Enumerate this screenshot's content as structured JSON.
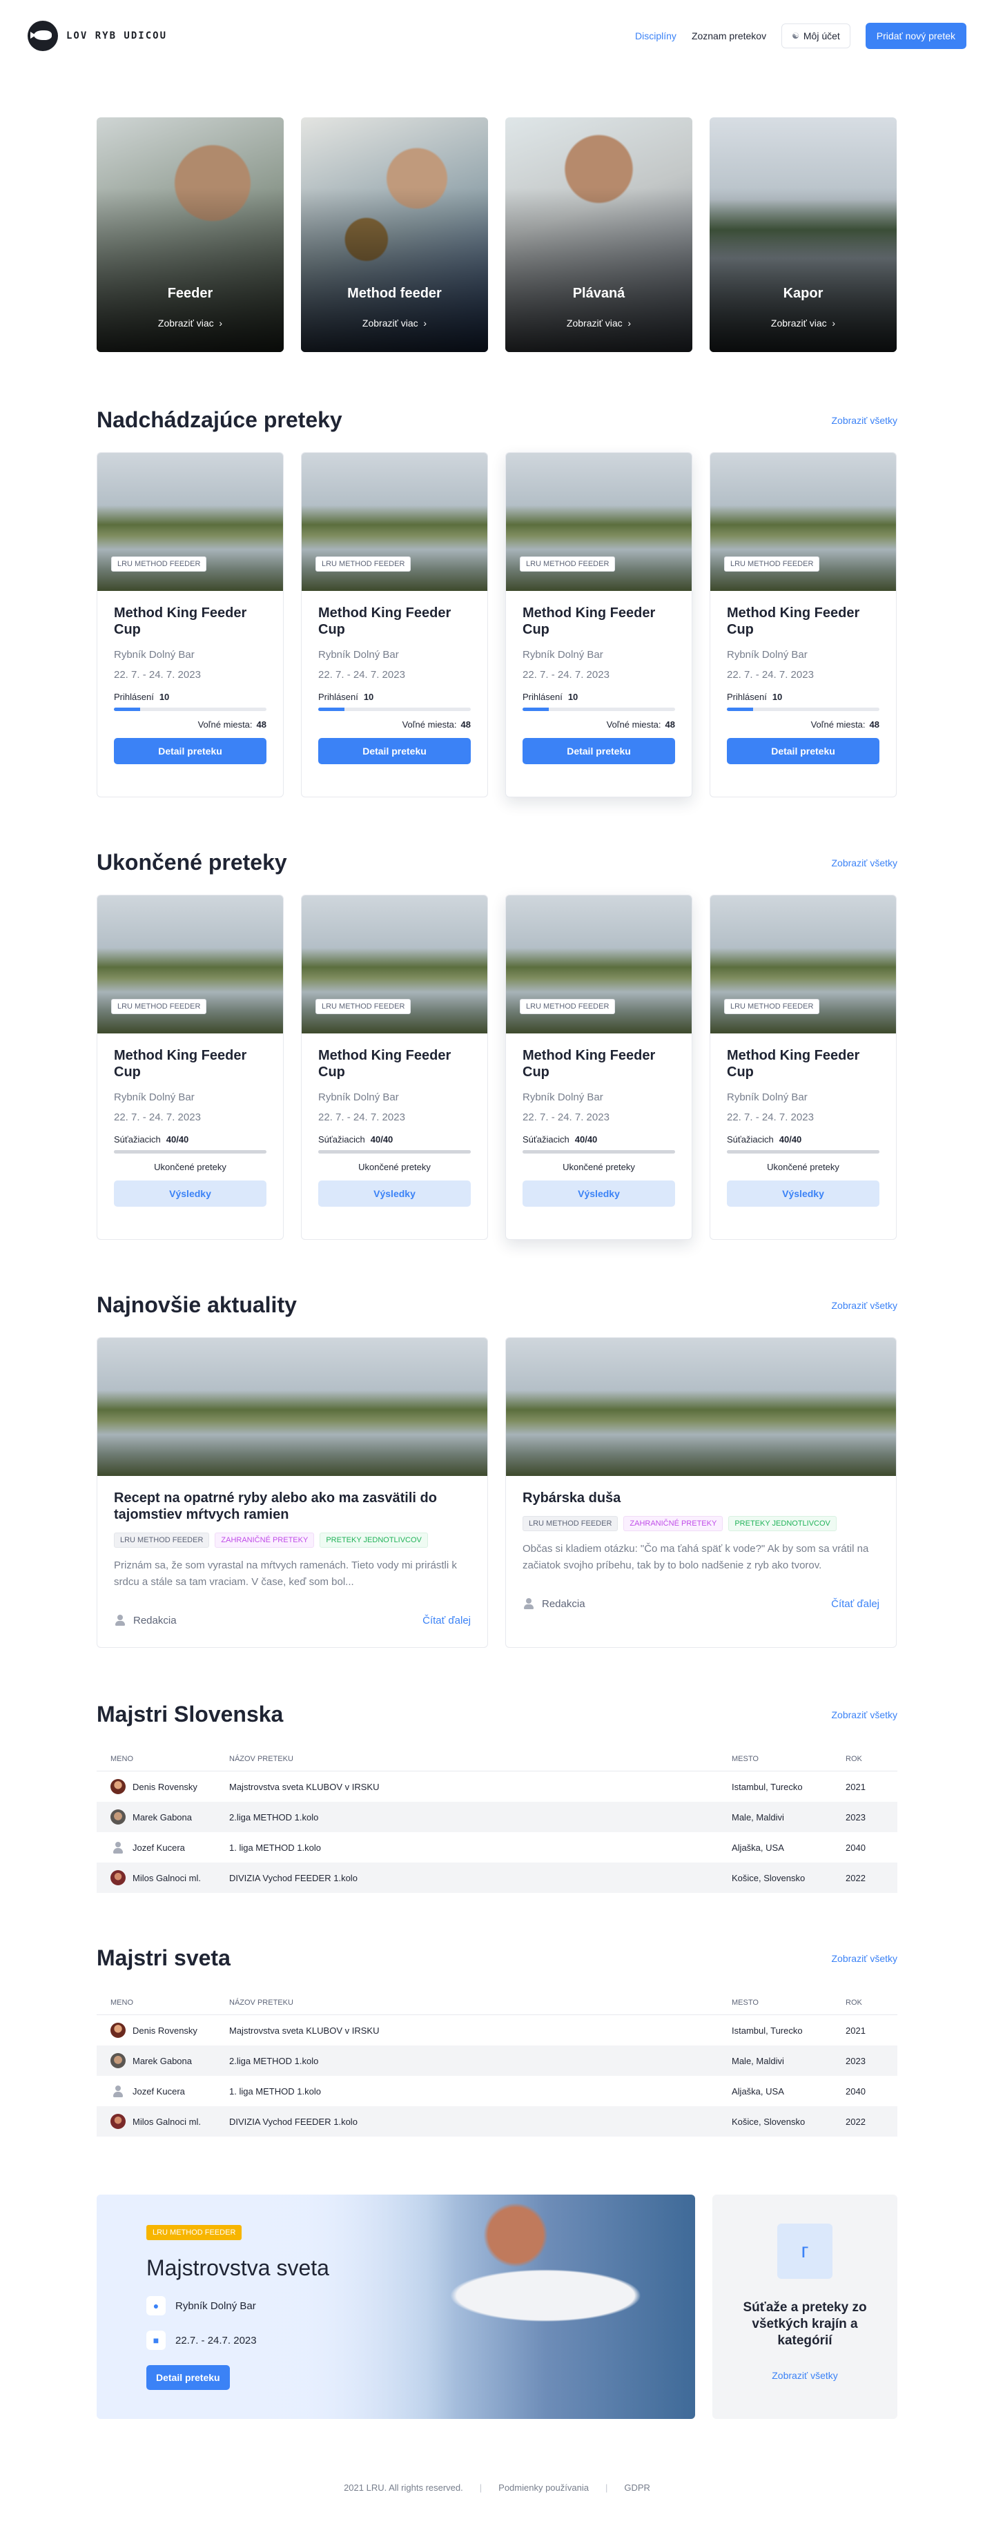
{
  "header": {
    "logo_text": "LOV RYB UDICOU",
    "nav": [
      {
        "label": "Disciplíny",
        "active": true
      },
      {
        "label": "Zoznam pretekov",
        "active": false
      }
    ],
    "account_label": "Môj účet",
    "add_race_label": "Pridať nový pretek"
  },
  "disciplines": [
    {
      "name": "Feeder",
      "more": "Zobraziť viac"
    },
    {
      "name": "Method feeder",
      "more": "Zobraziť viac"
    },
    {
      "name": "Plávaná",
      "more": "Zobraziť viac"
    },
    {
      "name": "Kapor",
      "more": "Zobraziť viac"
    }
  ],
  "upcoming": {
    "title": "Nadchádzajúce preteky",
    "see_all": "Zobraziť všetky",
    "cards": [
      {
        "tag": "LRU METHOD FEEDER",
        "title": "Method King Feeder Cup",
        "place": "Rybník Dolný Bar",
        "date": "22. 7. - 24. 7. 2023",
        "reg_label": "Prihlásení",
        "reg_value": "10",
        "progress": 0.17,
        "free_label": "Voľné miesta:",
        "free_value": "48",
        "button": "Detail preteku"
      },
      {
        "tag": "LRU METHOD FEEDER",
        "title": "Method King Feeder Cup",
        "place": "Rybník Dolný Bar",
        "date": "22. 7. - 24. 7. 2023",
        "reg_label": "Prihlásení",
        "reg_value": "10",
        "progress": 0.17,
        "free_label": "Voľné miesta:",
        "free_value": "48",
        "button": "Detail preteku"
      },
      {
        "tag": "LRU METHOD FEEDER",
        "title": "Method King Feeder Cup",
        "place": "Rybník Dolný Bar",
        "date": "22. 7. - 24. 7. 2023",
        "reg_label": "Prihlásení",
        "reg_value": "10",
        "progress": 0.17,
        "free_label": "Voľné miesta:",
        "free_value": "48",
        "button": "Detail preteku"
      },
      {
        "tag": "LRU METHOD FEEDER",
        "title": "Method King Feeder Cup",
        "place": "Rybník Dolný Bar",
        "date": "22. 7. - 24. 7. 2023",
        "reg_label": "Prihlásení",
        "reg_value": "10",
        "progress": 0.17,
        "free_label": "Voľné miesta:",
        "free_value": "48",
        "button": "Detail preteku"
      }
    ]
  },
  "finished": {
    "title": "Ukončené preteky",
    "see_all": "Zobraziť všetky",
    "cards": [
      {
        "tag": "LRU METHOD FEEDER",
        "title": "Method King Feeder Cup",
        "place": "Rybník Dolný Bar",
        "date": "22. 7. - 24. 7. 2023",
        "reg_label": "Súťažiacich",
        "reg_value": "40/40",
        "progress": 1.0,
        "status": "Ukončené preteky",
        "button": "Výsledky"
      },
      {
        "tag": "LRU METHOD FEEDER",
        "title": "Method King Feeder Cup",
        "place": "Rybník Dolný Bar",
        "date": "22. 7. - 24. 7. 2023",
        "reg_label": "Súťažiacich",
        "reg_value": "40/40",
        "progress": 1.0,
        "status": "Ukončené preteky",
        "button": "Výsledky"
      },
      {
        "tag": "LRU METHOD FEEDER",
        "title": "Method King Feeder Cup",
        "place": "Rybník Dolný Bar",
        "date": "22. 7. - 24. 7. 2023",
        "reg_label": "Súťažiacich",
        "reg_value": "40/40",
        "progress": 1.0,
        "status": "Ukončené preteky",
        "button": "Výsledky"
      },
      {
        "tag": "LRU METHOD FEEDER",
        "title": "Method King Feeder Cup",
        "place": "Rybník Dolný Bar",
        "date": "22. 7. - 24. 7. 2023",
        "reg_label": "Súťažiacich",
        "reg_value": "40/40",
        "progress": 1.0,
        "status": "Ukončené preteky",
        "button": "Výsledky"
      }
    ]
  },
  "news": {
    "title": "Najnovšie aktuality",
    "see_all": "Zobraziť všetky",
    "items": [
      {
        "title": "Recept na opatrné ryby alebo ako ma zasvätili do tajomstiev mŕtvych ramien",
        "tags": [
          "LRU METHOD FEEDER",
          "ZAHRANIČNÉ PRETEKY",
          "PRETEKY JEDNOTLIVCOV"
        ],
        "excerpt": "Priznám sa, že som vyrastal na mŕtvych ramenách. Tieto vody mi prirástli k srdcu a stále sa tam vraciam. V čase, keď som bol...",
        "author": "Redakcia",
        "read_more": "Čítať ďalej"
      },
      {
        "title": "Rybárska duša",
        "tags": [
          "LRU METHOD FEEDER",
          "ZAHRANIČNÉ PRETEKY",
          "PRETEKY JEDNOTLIVCOV"
        ],
        "excerpt": "Občas si kladiem otázku: \"Čo ma ťahá späť k vode?\" Ak by som sa vrátil na začiatok svojho príbehu, tak by to bolo nadšenie z ryb ako tvorov.",
        "author": "Redakcia",
        "read_more": "Čítať ďalej"
      }
    ]
  },
  "masters_sk": {
    "title": "Majstri Slovenska",
    "see_all": "Zobraziť všetky",
    "headers": [
      "MENO",
      "NÁZOV PRETEKU",
      "MESTO",
      "ROK"
    ],
    "rows": [
      {
        "name": "Denis Rovensky",
        "race": "Majstrovstva sveta KLUBOV v IRSKU",
        "city": "Istambul, Turecko",
        "year": "2021"
      },
      {
        "name": "Marek Gabona",
        "race": "2.liga METHOD 1.kolo",
        "city": "Male, Maldivi",
        "year": "2023"
      },
      {
        "name": "Jozef Kucera",
        "race": "1. liga METHOD 1.kolo",
        "city": "Aljaška, USA",
        "year": "2040"
      },
      {
        "name": "Milos Galnoci ml.",
        "race": "DIVIZIA Vychod FEEDER 1.kolo",
        "city": "Košice, Slovensko",
        "year": "2022"
      }
    ]
  },
  "masters_world": {
    "title": "Majstri sveta",
    "see_all": "Zobraziť všetky",
    "headers": [
      "MENO",
      "NÁZOV PRETEKU",
      "MESTO",
      "ROK"
    ],
    "rows": [
      {
        "name": "Denis Rovensky",
        "race": "Majstrovstva sveta KLUBOV v IRSKU",
        "city": "Istambul, Turecko",
        "year": "2021"
      },
      {
        "name": "Marek Gabona",
        "race": "2.liga METHOD 1.kolo",
        "city": "Male, Maldivi",
        "year": "2023"
      },
      {
        "name": "Jozef Kucera",
        "race": "1. liga METHOD 1.kolo",
        "city": "Aljaška, USA",
        "year": "2040"
      },
      {
        "name": "Milos Galnoci ml.",
        "race": "DIVIZIA Vychod FEEDER 1.kolo",
        "city": "Košice, Slovensko",
        "year": "2022"
      }
    ]
  },
  "promo": {
    "tag": "LRU METHOD FEEDER",
    "title": "Majstrovstva sveta",
    "place": "Rybník Dolný Bar",
    "date": "22.7. - 24.7. 2023",
    "button": "Detail preteku",
    "side_text": "Súťaže a preteky zo všetkých krajín a kategórií",
    "side_link": "Zobraziť všetky"
  },
  "footer": {
    "copyright": "2021 LRU. All rights reserved.",
    "terms": "Podmienky používania",
    "gdpr": "GDPR"
  },
  "colors": {
    "accent": "#3b82f6",
    "tag_yellow": "#f7b500",
    "tag_purple": "#c04de8",
    "tag_green": "#22b35a"
  }
}
